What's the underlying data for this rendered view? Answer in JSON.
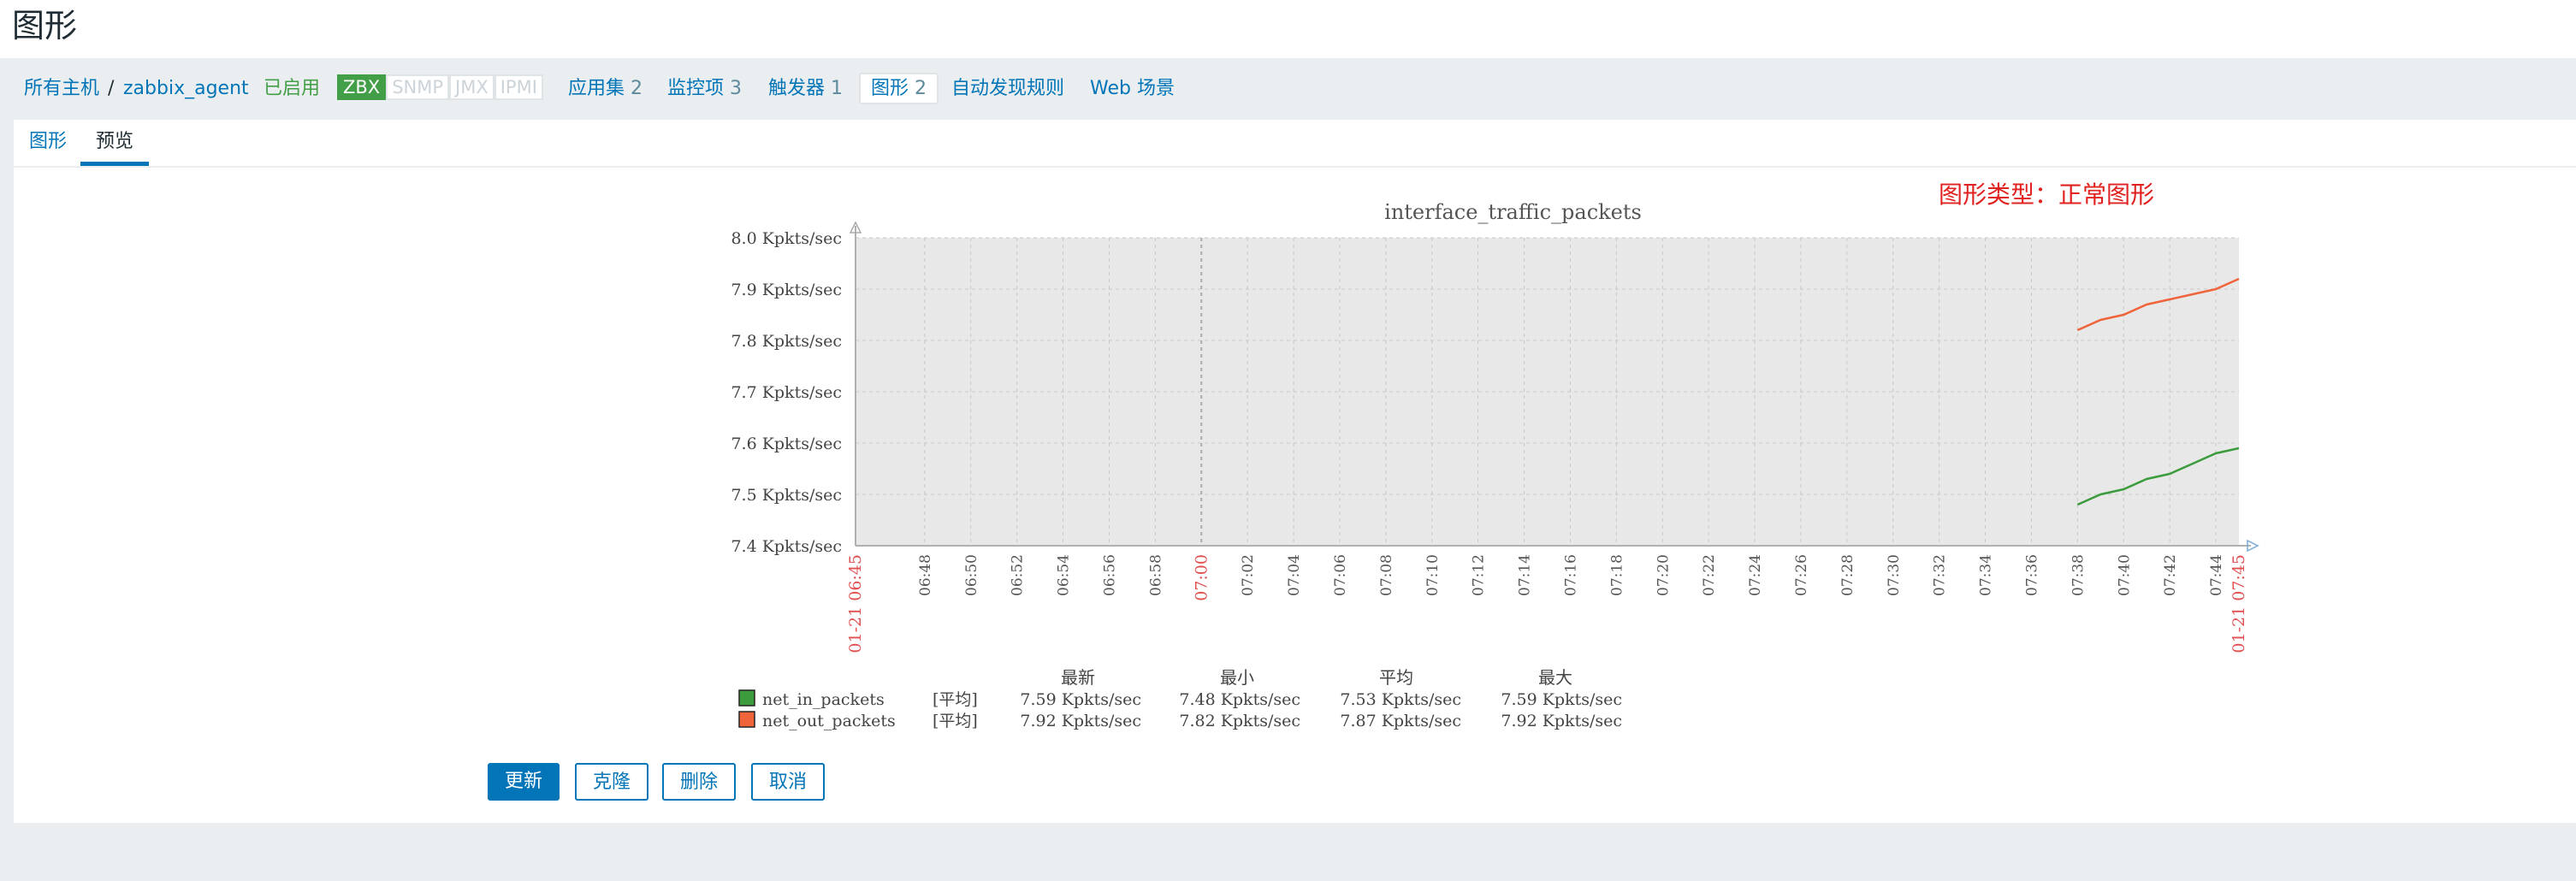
{
  "page": {
    "title": "图形"
  },
  "nav": {
    "all_hosts": "所有主机",
    "separator": "/",
    "host": "zabbix_agent",
    "status": "已启用",
    "badges": [
      "ZBX",
      "SNMP",
      "JMX",
      "IPMI"
    ],
    "applications": {
      "label": "应用集",
      "count": "2"
    },
    "items": {
      "label": "监控项",
      "count": "3"
    },
    "triggers": {
      "label": "触发器",
      "count": "1"
    },
    "graphs": {
      "label": "图形",
      "count": "2"
    },
    "discovery": "自动发现规则",
    "web": "Web 场景"
  },
  "tabs": {
    "graph": "图形",
    "preview": "预览"
  },
  "annotation": "图形类型：正常图形",
  "chart_data": {
    "type": "line",
    "title": "interface_traffic_packets",
    "ylim": [
      7.4,
      8.0
    ],
    "y_ticks": [
      "8.0 Kpkts/sec",
      "7.9 Kpkts/sec",
      "7.8 Kpkts/sec",
      "7.7 Kpkts/sec",
      "7.6 Kpkts/sec",
      "7.5 Kpkts/sec",
      "7.4 Kpkts/sec"
    ],
    "x_start_label": "01-21 06:45",
    "x_end_label": "01-21 07:45",
    "x_mid_label": "07:00",
    "x_ticks": [
      "06:48",
      "06:50",
      "06:52",
      "06:54",
      "06:56",
      "06:58",
      "07:02",
      "07:04",
      "07:06",
      "07:08",
      "07:10",
      "07:12",
      "07:14",
      "07:16",
      "07:18",
      "07:20",
      "07:22",
      "07:24",
      "07:26",
      "07:28",
      "07:30",
      "07:32",
      "07:34",
      "07:36",
      "07:38",
      "07:40",
      "07:42",
      "07:44"
    ],
    "series": [
      {
        "name": "net_in_packets",
        "color": "#3c9b3c",
        "x": [
          "07:38",
          "07:39",
          "07:40",
          "07:41",
          "07:42",
          "07:43",
          "07:44",
          "07:45"
        ],
        "values": [
          7.48,
          7.5,
          7.51,
          7.53,
          7.54,
          7.56,
          7.58,
          7.59
        ]
      },
      {
        "name": "net_out_packets",
        "color": "#f0643c",
        "x": [
          "07:38",
          "07:39",
          "07:40",
          "07:41",
          "07:42",
          "07:43",
          "07:44",
          "07:45"
        ],
        "values": [
          7.82,
          7.84,
          7.85,
          7.87,
          7.88,
          7.89,
          7.9,
          7.92
        ]
      }
    ],
    "legend": {
      "headers": [
        "最新",
        "最小",
        "平均",
        "最大"
      ],
      "rows": [
        {
          "name": "net_in_packets",
          "func": "[平均]",
          "last": "7.59 Kpkts/sec",
          "min": "7.48 Kpkts/sec",
          "avg": "7.53 Kpkts/sec",
          "max": "7.59 Kpkts/sec",
          "color": "#3c9b3c"
        },
        {
          "name": "net_out_packets",
          "func": "[平均]",
          "last": "7.92 Kpkts/sec",
          "min": "7.82 Kpkts/sec",
          "avg": "7.87 Kpkts/sec",
          "max": "7.92 Kpkts/sec",
          "color": "#f0643c"
        }
      ]
    }
  },
  "buttons": {
    "update": "更新",
    "clone": "克隆",
    "delete": "删除",
    "cancel": "取消"
  }
}
